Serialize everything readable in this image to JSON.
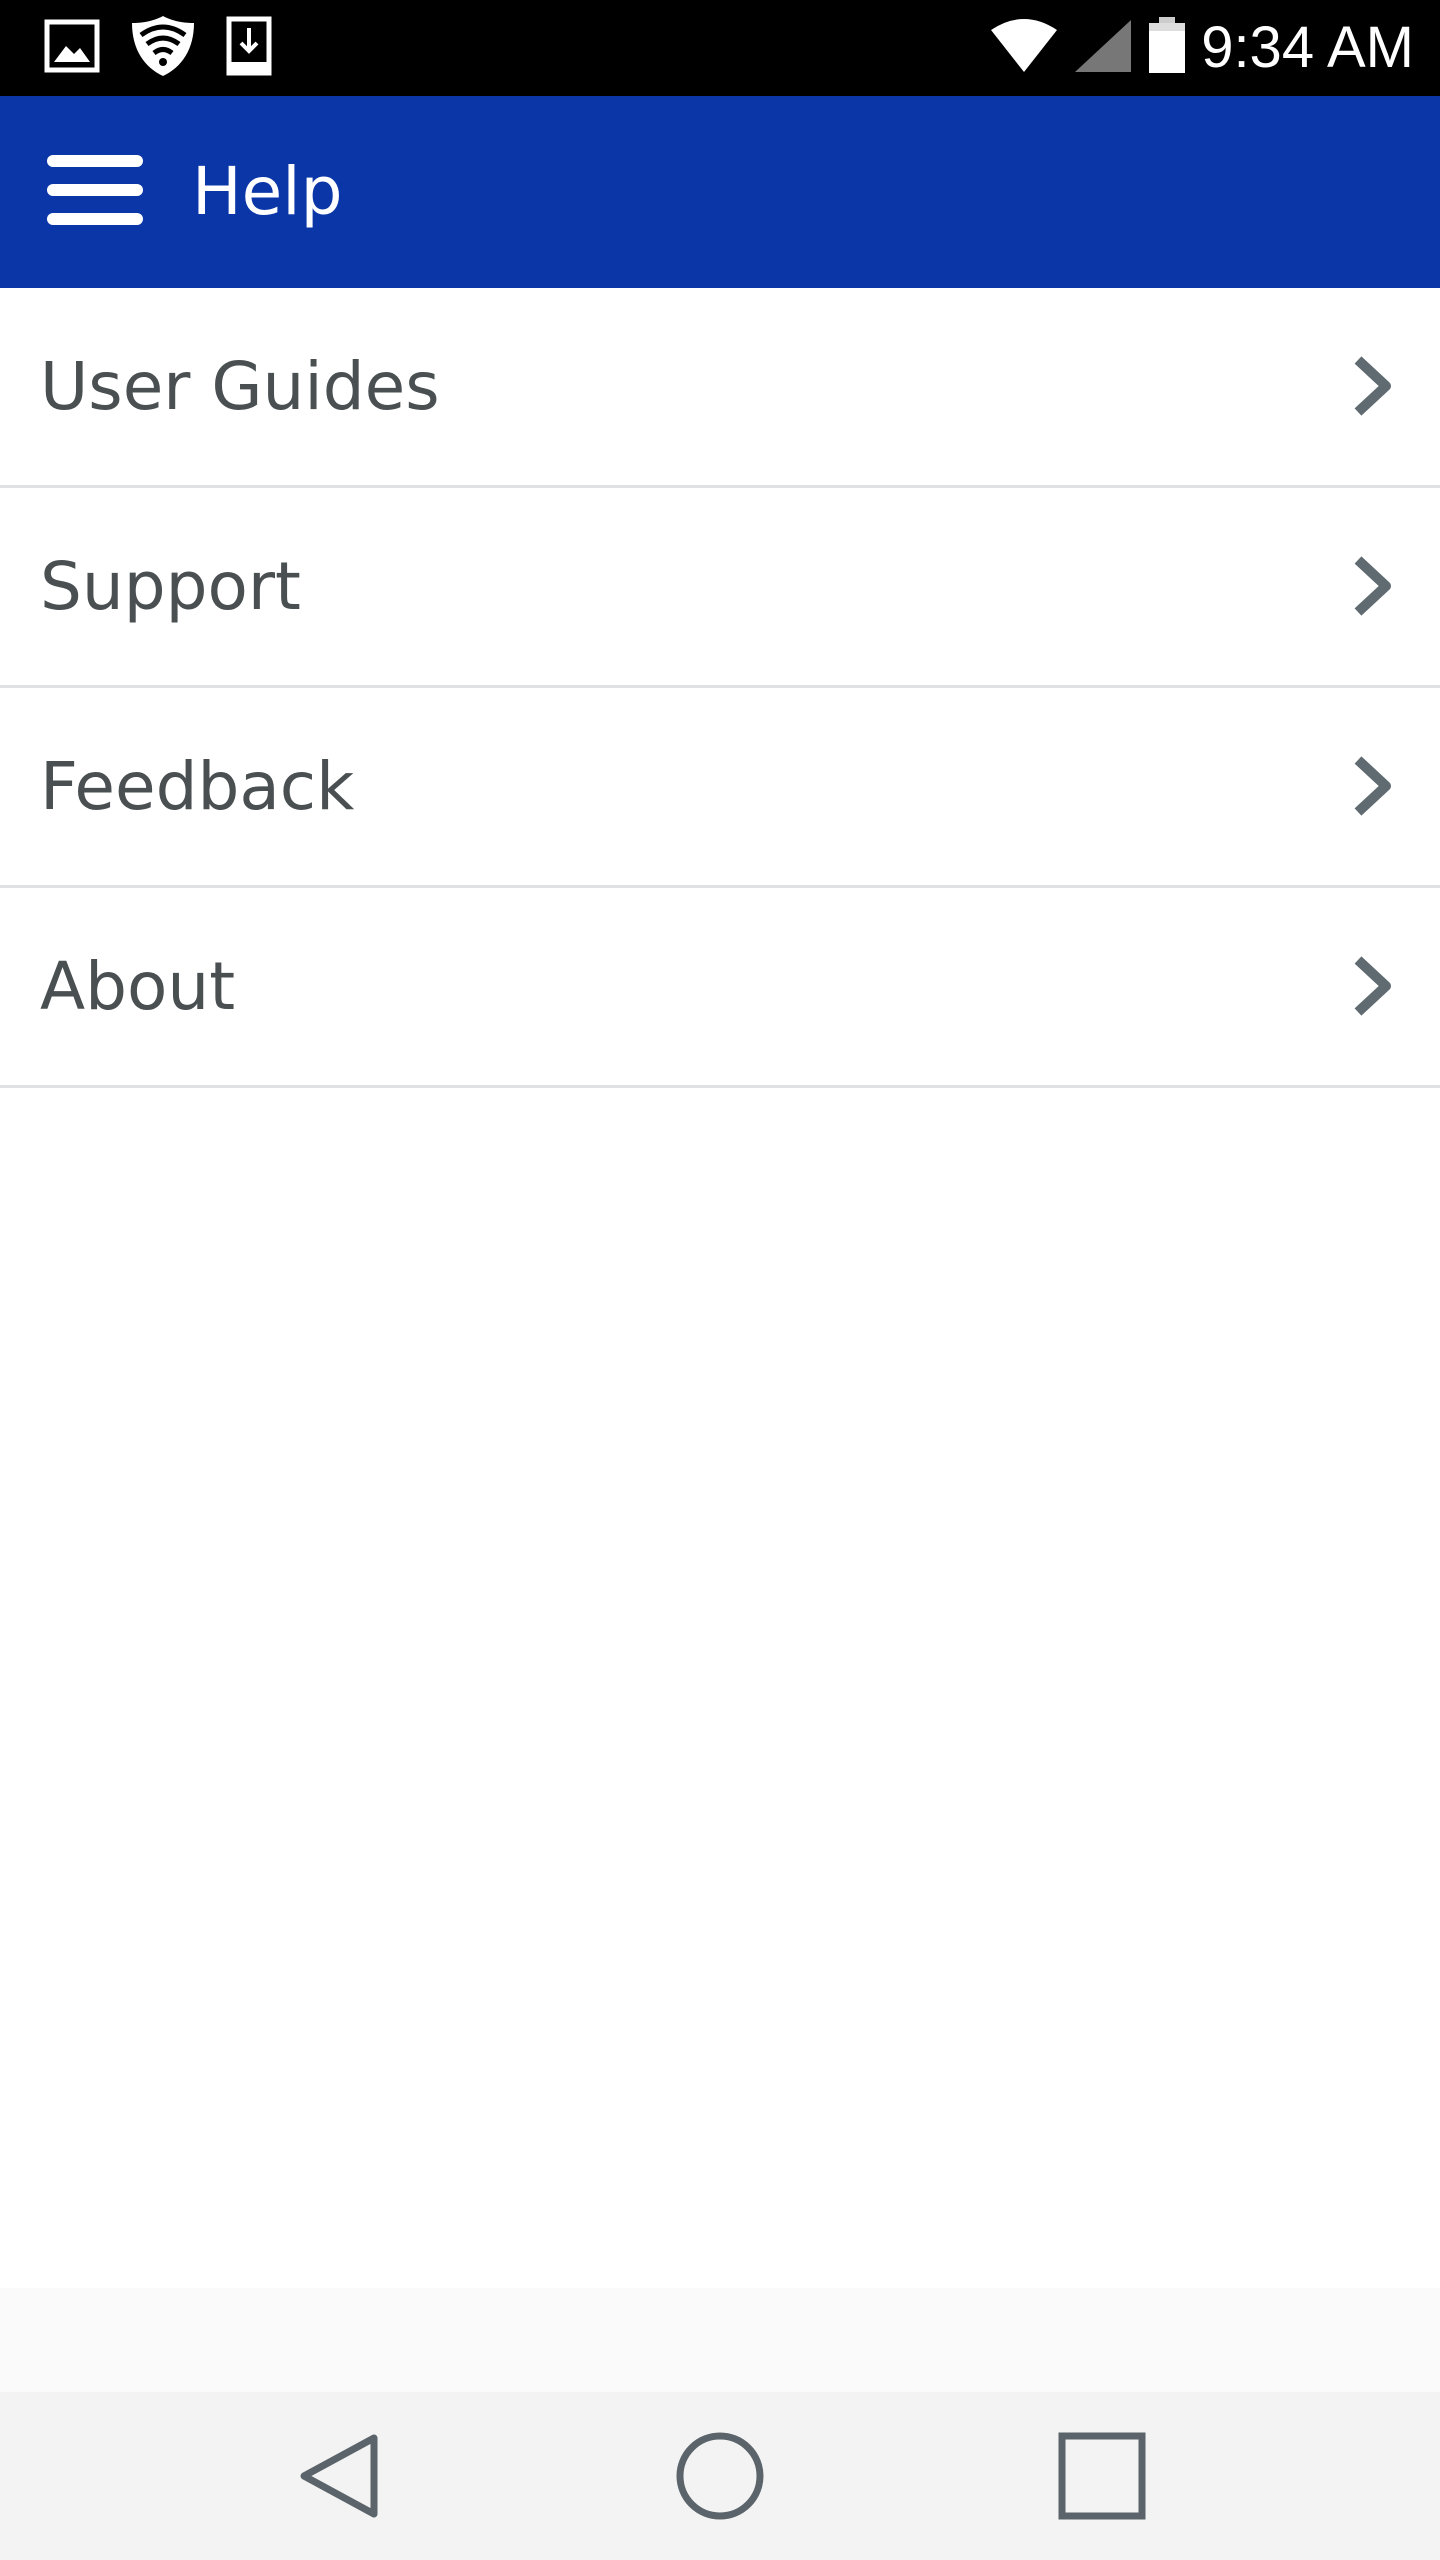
{
  "status_bar": {
    "time": "9:34 AM",
    "icons": [
      "image-icon",
      "shield-wifi-icon",
      "download-icon",
      "wifi-icon",
      "signal-icon",
      "battery-icon"
    ]
  },
  "app_bar": {
    "title": "Help",
    "menu_icon": "hamburger-menu-icon",
    "background_color": "#0a36a8"
  },
  "menu": {
    "items": [
      {
        "label": "User Guides",
        "icon": "chevron-right-icon"
      },
      {
        "label": "Support",
        "icon": "chevron-right-icon"
      },
      {
        "label": "Feedback",
        "icon": "chevron-right-icon"
      },
      {
        "label": "About",
        "icon": "chevron-right-icon"
      }
    ]
  },
  "nav_bar": {
    "buttons": [
      "back-icon",
      "home-icon",
      "recents-icon"
    ]
  }
}
